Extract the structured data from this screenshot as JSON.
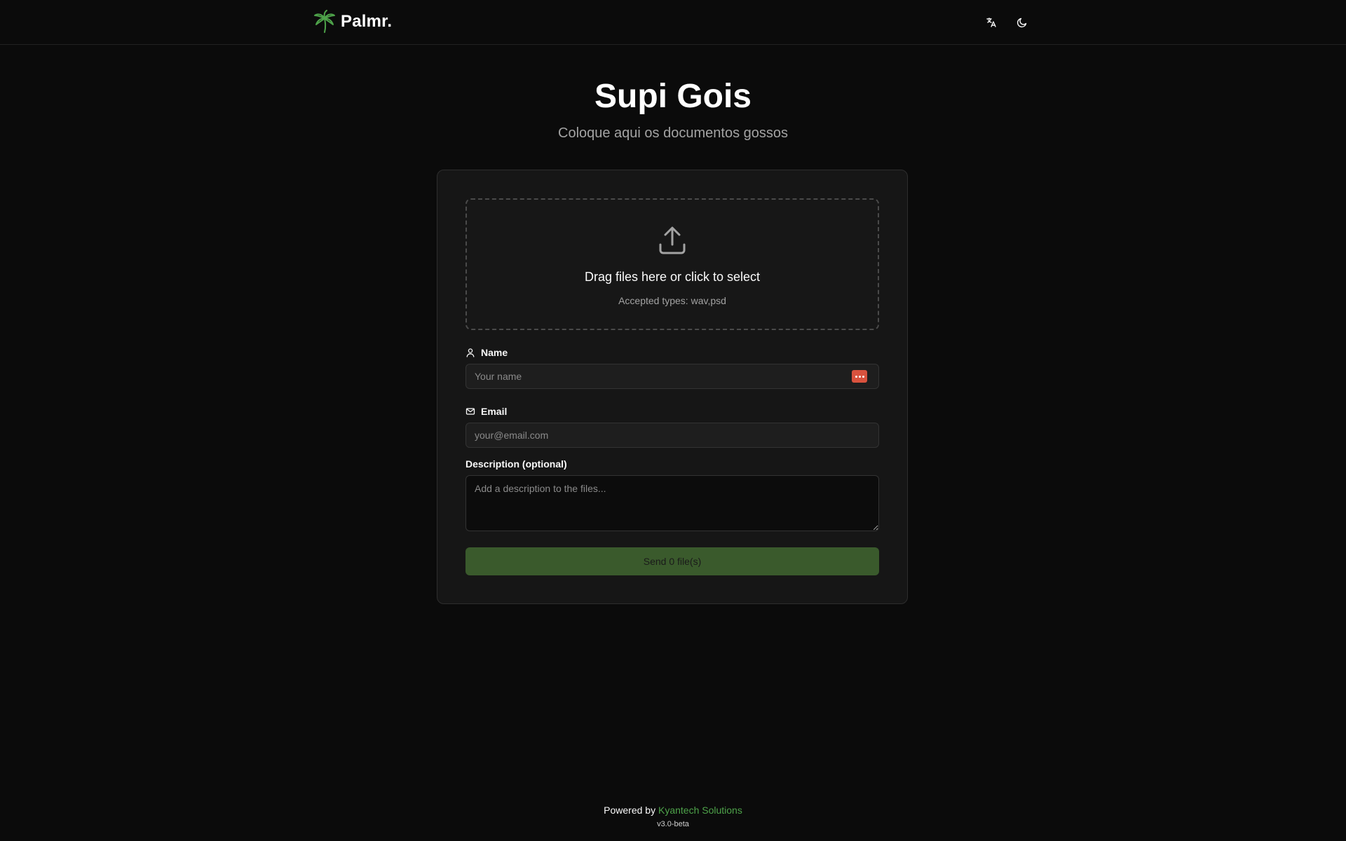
{
  "brand": {
    "name": "Palmr.",
    "logo_icon": "palm-tree-icon",
    "accent_color": "#4ea34a"
  },
  "header": {
    "language_icon": "language-icon",
    "theme_icon": "moon-icon"
  },
  "hero": {
    "title": "Supi Gois",
    "subtitle": "Coloque aqui os documentos gossos"
  },
  "dropzone": {
    "icon": "upload-icon",
    "text": "Drag files here or click to select",
    "accepted_types": "Accepted types: wav,psd"
  },
  "form": {
    "name": {
      "label": "Name",
      "icon": "user-icon",
      "placeholder": "Your name",
      "value": "",
      "badge_icon": "password-manager-icon"
    },
    "email": {
      "label": "Email",
      "icon": "mail-icon",
      "placeholder": "your@email.com",
      "value": ""
    },
    "description": {
      "label": "Description (optional)",
      "placeholder": "Add a description to the files...",
      "value": ""
    },
    "submit_label": "Send 0 file(s)",
    "submit_color": "#3a5a2c"
  },
  "footer": {
    "powered_prefix": "Powered by",
    "powered_link": "Kyantech Solutions",
    "version": "v3.0-beta"
  }
}
